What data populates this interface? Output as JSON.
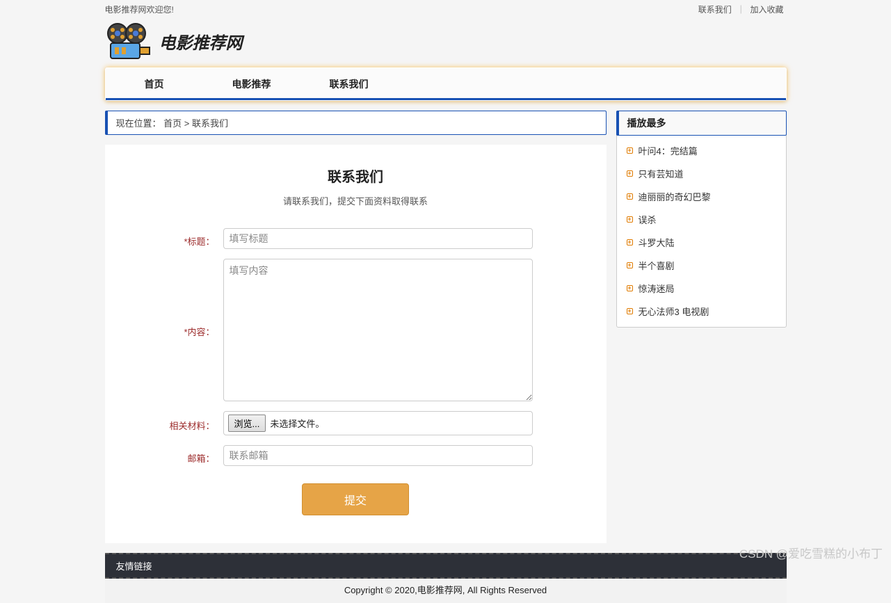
{
  "topbar": {
    "welcome": "电影推荐网欢迎您!",
    "contact": "联系我们",
    "favorite": "加入收藏"
  },
  "site_name": "电影推荐网",
  "nav": {
    "items": [
      "首页",
      "电影推荐",
      "联系我们"
    ]
  },
  "breadcrumb": {
    "label": "现在位置：",
    "home": "首页",
    "sep": ">",
    "current": "联系我们"
  },
  "page": {
    "title": "联系我们",
    "subtitle": "请联系我们，提交下面资料取得联系"
  },
  "form": {
    "title_label": "*标题：",
    "title_placeholder": "填写标题",
    "content_label": "*内容：",
    "content_placeholder": "填写内容",
    "material_label": "相关材料：",
    "browse_button": "浏览...",
    "no_file": "未选择文件。",
    "email_label": "邮箱：",
    "email_placeholder": "联系邮箱",
    "submit": "提交"
  },
  "sidebar": {
    "title": "播放最多",
    "items": [
      "叶问4：完结篇",
      "只有芸知道",
      "迪丽丽的奇幻巴黎",
      "误杀",
      "斗罗大陆",
      "半个喜剧",
      "惊涛迷局",
      "无心法师3 电视剧"
    ]
  },
  "footer": {
    "friend_links": "友情链接",
    "copyright": "Copyright © 2020,电影推荐网, All Rights Reserved"
  },
  "watermark": "CSDN @爱吃雪糕的小布丁"
}
